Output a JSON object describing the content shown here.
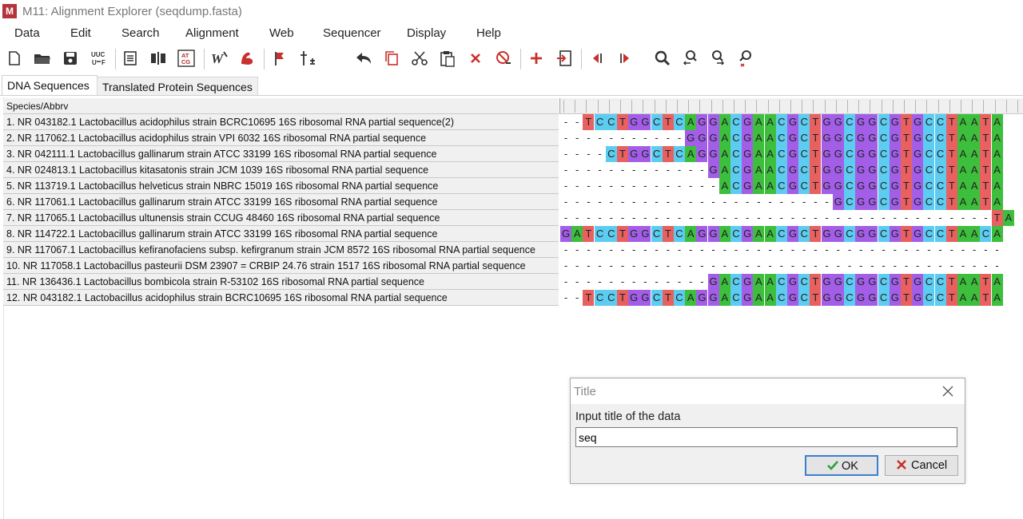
{
  "window": {
    "title": "M11: Alignment Explorer (seqdump.fasta)",
    "app_icon_text": "M"
  },
  "menu": [
    "Data",
    "Edit",
    "Search",
    "Alignment",
    "Web",
    "Sequencer",
    "Display",
    "Help"
  ],
  "toolbar_icons": [
    "new-icon",
    "open-icon",
    "save-icon",
    "uuc-to-utf-icon",
    "properties-icon",
    "columns-icon",
    "atcg-icon",
    "w-icon",
    "muscle-icon",
    "flag-icon",
    "sequence-to-align-icon",
    "undo-icon",
    "copy-icon",
    "cut-icon",
    "paste-icon",
    "delete-icon",
    "delete-gap-icon",
    "add-icon",
    "import-icon",
    "previous-icon",
    "next-icon",
    "search-icon",
    "search-previous-icon",
    "search-next-icon",
    "search-clear-icon"
  ],
  "toolbar_labels": {
    "uuc_top": "UUC",
    "uuc_bottom": "U",
    "uuc_f": "F",
    "atcg_top": "AT",
    "atcg_bottom": "CG",
    "w": "W"
  },
  "tabs": [
    "DNA Sequences",
    "Translated Protein Sequences"
  ],
  "table": {
    "header": "Species/Abbrv",
    "rows": [
      {
        "name": "1. NR 043182.1 Lactobacillus acidophilus strain BCRC10695 16S ribosomal RNA partial sequence(2)",
        "seq": "--TCCTGGCTCAGGACGAACGCTGGCGGCGTGCCTAATA"
      },
      {
        "name": "2. NR 117062.1 Lactobacillus acidophilus strain VPI 6032 16S ribosomal RNA partial sequence",
        "seq": "-----------GGGACGAACGCTGGCGGCGTGCCTAATA"
      },
      {
        "name": "3. NR 042111.1 Lactobacillus gallinarum strain ATCC 33199 16S ribosomal RNA partial sequence",
        "seq": "----CTGGCTCAGGACGAACGCTGGCGGCGTGCCTAATA"
      },
      {
        "name": "4. NR 024813.1 Lactobacillus kitasatonis strain JCM 1039 16S ribosomal RNA partial sequence",
        "seq": "-------------GACGAACGCTGGCGGCGTGCCTAATA"
      },
      {
        "name": "5. NR 113719.1 Lactobacillus helveticus strain NBRC 15019 16S ribosomal RNA partial sequence",
        "seq": "--------------ACGAACGCTGGCGGCGTGCCTAATA"
      },
      {
        "name": "6. NR 117061.1 Lactobacillus gallinarum strain ATCC 33199 16S ribosomal RNA partial sequence",
        "seq": "------------------------GCGGCGTGCCTAATA"
      },
      {
        "name": "7. NR 117065.1 Lactobacillus ultunensis strain CCUG 48460 16S ribosomal RNA partial sequence",
        "seq": "--------------------------------------TA"
      },
      {
        "name": "8. NR 114722.1 Lactobacillus gallinarum strain ATCC 33199 16S ribosomal RNA partial sequence",
        "seq": "GATCCTGGCTCAGGACGAACGCTGGCGGCGTGCCTAACA"
      },
      {
        "name": "9. NR 117067.1 Lactobacillus kefiranofaciens subsp. kefirgranum strain JCM 8572 16S ribosomal RNA partial sequence",
        "seq": "---------------------------------------"
      },
      {
        "name": "10. NR 117058.1 Lactobacillus pasteurii DSM 23907 = CRBIP 24.76 strain 1517 16S ribosomal RNA partial sequence",
        "seq": "---------------------------------------"
      },
      {
        "name": "11. NR 136436.1 Lactobacillus bombicola strain R-53102 16S ribosomal RNA partial sequence",
        "seq": "-------------GACGAACGCTGGCGGCGTGCCTAATA"
      },
      {
        "name": "12. NR 043182.1 Lactobacillus acidophilus strain BCRC10695 16S ribosomal RNA partial sequence",
        "seq": "--TCCTGGCTCAGGACGAACGCTGGCGGCGTGCCTAATA"
      }
    ]
  },
  "nucleotide_colors": {
    "A": "#3dbf3d",
    "C": "#5ccdf1",
    "G": "#a35ee8",
    "T": "#e8605f"
  },
  "dialog": {
    "title": "Title",
    "prompt": "Input title of the data",
    "input_value": "seq",
    "ok_label": "OK",
    "cancel_label": "Cancel"
  }
}
